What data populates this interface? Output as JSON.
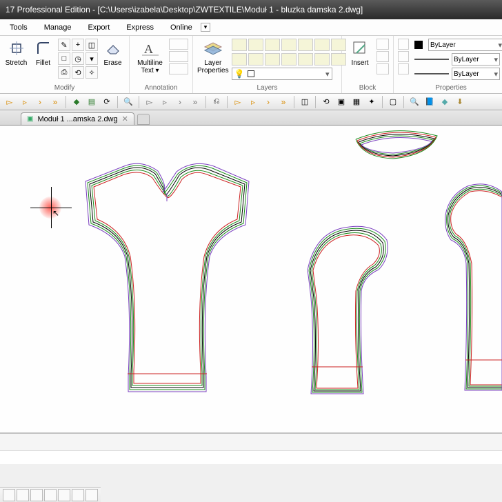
{
  "title": "17 Professional Edition - [C:\\Users\\izabela\\Desktop\\ZWTEXTILE\\Moduł 1 - bluzka damska 2.dwg]",
  "menus": {
    "m1": "Tools",
    "m2": "Manage",
    "m3": "Export",
    "m4": "Express",
    "m5": "Online"
  },
  "ribbon": {
    "modify": {
      "label": "Modify",
      "stretch": "Stretch",
      "fillet": "Fillet",
      "erase": "Erase"
    },
    "annotation": {
      "label": "Annotation",
      "multiline": "Multiline\nText ▾"
    },
    "layers": {
      "label": "Layers",
      "layerprops": "Layer\nProperties"
    },
    "block": {
      "label": "Block",
      "insert": "Insert"
    },
    "properties": {
      "label": "Properties",
      "bylayer1": "ByLayer",
      "bylayer2": "ByLayer",
      "bylayer3": "ByLayer"
    }
  },
  "tab": {
    "name": "Moduł 1 ...amska 2.dwg"
  }
}
